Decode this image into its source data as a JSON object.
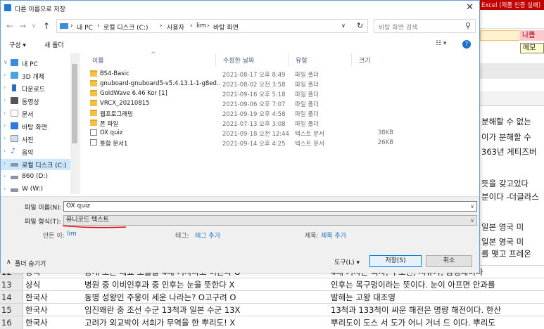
{
  "excel": {
    "top_right_title": "Excel (제품 인증 실패)",
    "cell_nabun": "나쁨",
    "cell_memo": "메모",
    "right_texts": [
      "분해할 수 없는",
      "이가 분해할 수",
      "363년 게티즈버",
      "뜻을 갖고있다",
      "분이다 -더글라스",
      "일본 영국 미",
      "일본 영국 미",
      "를 맺고 프레온"
    ],
    "rows": [
      {
        "num": "12",
        "b": "상식",
        "c": "동계 오픈 대표 오를을 4대 기자라고 이른다 O",
        "d": "4대 기자는 뇌자, 구오린, 서유가, 금병매이다"
      },
      {
        "num": "13",
        "b": "상식",
        "c": "병원 중 이비인후과 중 인후는 눈을 뜻한다 X",
        "d": "인후는 목구멍이라는 뜻이다. 눈이 아프면 안과를"
      },
      {
        "num": "14",
        "b": "한국사",
        "c": "동명 성왕인 주몽이 세운 나라는? O고구려 O",
        "d": "발해는 고왕 대조영"
      },
      {
        "num": "15",
        "b": "한국사",
        "c": "임진왜란 중 조선 수군 13척과 일본 수군 13X",
        "d": "13척과 133척이 싸운 해전은 명량 해전이다. 한산"
      },
      {
        "num": "16",
        "b": "한국사",
        "c": "고려가 외교박이 서희가 무역을 한 뿌리도! X",
        "d": "뿌리도이 도스 서 도가 어니 거너 드 이다. 뿌리도"
      }
    ]
  },
  "dialog": {
    "title": "다른 이름으로 저장",
    "breadcrumb": [
      "내 PC",
      "로컬 디스크 (C:)",
      "사용자",
      "lim",
      "바탕 화면"
    ],
    "search_placeholder": "바탕 화면 검색",
    "toolbar": {
      "organize": "구성 ▾",
      "new_folder": "새 폴더"
    },
    "nav": [
      {
        "label": "내 PC",
        "icon": "pc-icon",
        "color": "#3a8dde"
      },
      {
        "label": "3D 개체",
        "icon": "cube-icon",
        "color": "#4aa3df"
      },
      {
        "label": "다운로드",
        "icon": "download-icon",
        "color": "#2b6cc4"
      },
      {
        "label": "동영상",
        "icon": "video-icon",
        "color": "#555555"
      },
      {
        "label": "문서",
        "icon": "document-icon",
        "color": "#9aa7b5"
      },
      {
        "label": "바탕 화면",
        "icon": "desktop-icon",
        "color": "#2f7bd9"
      },
      {
        "label": "사진",
        "icon": "picture-icon",
        "color": "#7d8c9c"
      },
      {
        "label": "음악",
        "icon": "music-icon",
        "color": "#2f6fd0"
      },
      {
        "label": "로컬 디스크 (C:)",
        "icon": "drive-icon",
        "color": "#8a96a3"
      },
      {
        "label": "860 (D:)",
        "icon": "drive-icon",
        "color": "#8a96a3"
      },
      {
        "label": "W (W:)",
        "icon": "drive-icon",
        "color": "#8a96a3"
      }
    ],
    "columns": {
      "name": "이름",
      "date": "수정한 날짜",
      "type": "유형",
      "size": "크기"
    },
    "files": [
      {
        "name": "BS4-Basic",
        "date": "2021-08-17 오후 8:49",
        "type": "파일 폴더",
        "size": "",
        "kind": "folder"
      },
      {
        "name": "gnuboard-gnuboard5-v5.4.13.1-1-g8ed...",
        "date": "2021-08-02 오전 3:58",
        "type": "파일 폴더",
        "size": "",
        "kind": "folder"
      },
      {
        "name": "GoldWave 6.46 Kor [1]",
        "date": "2021-09-16 오후 5:18",
        "type": "파일 폴더",
        "size": "",
        "kind": "folder"
      },
      {
        "name": "VRCX_20210815",
        "date": "2021-09-06 오후 7:07",
        "type": "파일 폴더",
        "size": "",
        "kind": "folder"
      },
      {
        "name": "웹프로그래밍",
        "date": "2021-09-19 오후 4:58",
        "type": "파일 폴더",
        "size": "",
        "kind": "folder"
      },
      {
        "name": "폰 파일",
        "date": "2021-07-13 오후 3:08",
        "type": "파일 폴더",
        "size": "",
        "kind": "folder"
      },
      {
        "name": "OX quiz",
        "date": "2021-09-18 오전 12:44",
        "type": "텍스트 문서",
        "size": "38KB",
        "kind": "doc"
      },
      {
        "name": "통합 문서1",
        "date": "2021-09-14 오후 4:25",
        "type": "텍스트 문서",
        "size": "26KB",
        "kind": "doc"
      }
    ],
    "filename_label": "파일 이름(N):",
    "filename_value": "OX quiz",
    "filetype_label": "파일 형식(T):",
    "filetype_value": "유니코드 텍스트",
    "author_label": "만든 이:",
    "author_value": "lim",
    "tags_label": "태그:",
    "tags_value": "태그 추가",
    "title_label": "제목:",
    "title_value": "제목 추가",
    "hide_folders": "폴더 숨기기",
    "tools": "도구(L)",
    "save": "저장(S)",
    "cancel": "취소"
  }
}
